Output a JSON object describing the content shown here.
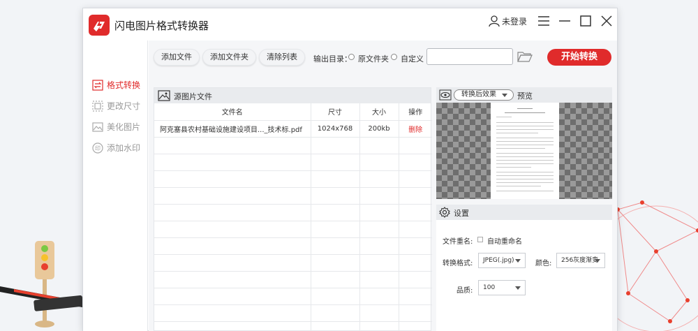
{
  "app": {
    "title": "闪电图片格式转换器",
    "login_label": "未登录"
  },
  "sidebar": {
    "items": [
      {
        "label": "格式转换",
        "active": true
      },
      {
        "label": "更改尺寸",
        "active": false
      },
      {
        "label": "美化图片",
        "active": false
      },
      {
        "label": "添加水印",
        "active": false
      }
    ]
  },
  "toolbar": {
    "add_file": "添加文件",
    "add_folder": "添加文件夹",
    "clear_list": "清除列表",
    "output_dir_label": "输出目录：",
    "option_source": "原文件夹",
    "option_custom": "自定义",
    "path_value": "",
    "start": "开始转换"
  },
  "files": {
    "panel_title": "源图片文件",
    "columns": [
      "文件名",
      "尺寸",
      "大小",
      "操作"
    ],
    "rows": [
      {
        "name": "阿克塞县农村基础设施建设项目..._技术标.pdf",
        "size": "1024x768",
        "filesize": "200kb",
        "action": "删除"
      }
    ]
  },
  "preview": {
    "effect_select": "转换后效果",
    "label": "预览"
  },
  "settings": {
    "title": "设置",
    "rename_label": "文件重名:",
    "auto_rename": "自动重命名",
    "format_label": "转换格式:",
    "format_value": "JPEG(.jpg)",
    "color_label": "颜色:",
    "color_value": "256灰度渐变",
    "quality_label": "品质:",
    "quality_value": "100"
  },
  "colors": {
    "accent": "#e02b2b",
    "panel_header": "#e9ebee"
  }
}
